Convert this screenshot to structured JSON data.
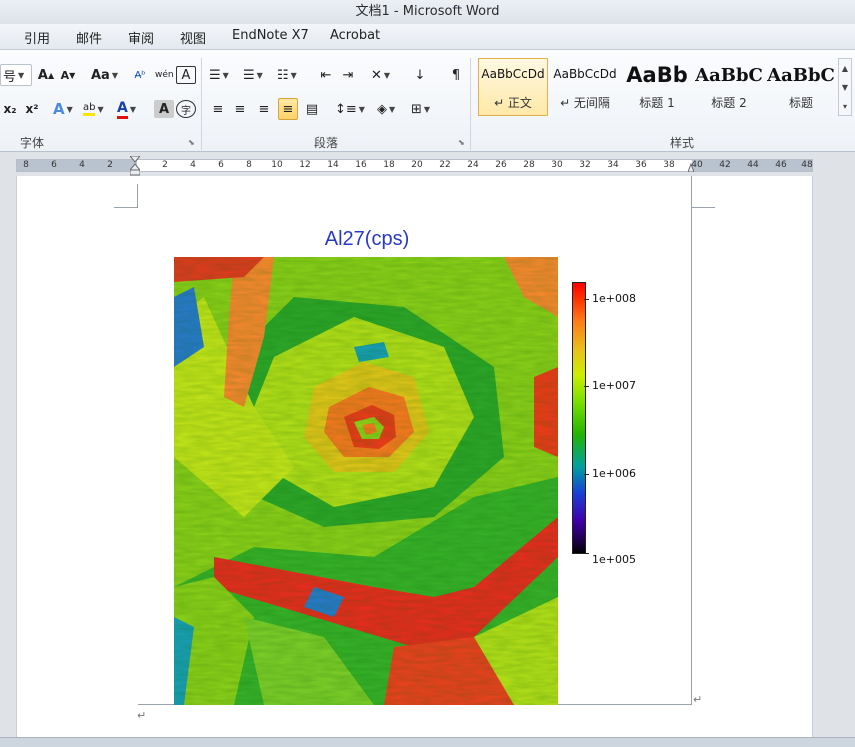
{
  "window": {
    "title": "文档1 - Microsoft Word"
  },
  "menu": {
    "tabs": [
      "引用",
      "邮件",
      "审阅",
      "视图",
      "EndNote X7",
      "Acrobat"
    ]
  },
  "ribbon": {
    "font_group_label": "字体",
    "paragraph_group_label": "段落",
    "styles_group_label": "样式",
    "font": {
      "size_fragment": "号",
      "grow_label": "A",
      "shrink_label": "A",
      "case_label": "Aa",
      "phonetic_label": "wén",
      "char_border_label": "A",
      "subscript_label": "x₂",
      "superscript_label": "x²",
      "effects_label": "A",
      "highlight_label": "ab",
      "font_color_label": "A",
      "char_shading_label": "A",
      "enclose_label": "字"
    },
    "styles": [
      {
        "sample": "AaBbCcDd",
        "name": "↵ 正文",
        "selected": true
      },
      {
        "sample": "AaBbCcDd",
        "name": "↵ 无间隔",
        "selected": false
      },
      {
        "sample": "AaBb",
        "name": "标题 1",
        "selected": false
      },
      {
        "sample": "AaBbC",
        "name": "标题 2",
        "selected": false
      },
      {
        "sample": "AaBbC",
        "name": "标题",
        "selected": false
      }
    ]
  },
  "ruler": {
    "left_ticks": [
      "8",
      "6",
      "4",
      "2"
    ],
    "right_ticks": [
      "2",
      "4",
      "6",
      "8",
      "10",
      "12",
      "14",
      "16",
      "18",
      "20",
      "22",
      "24",
      "26",
      "28",
      "30",
      "32",
      "34",
      "36",
      "38",
      "40",
      "42",
      "44",
      "46",
      "48"
    ]
  },
  "document": {
    "figure_title": "Al27(cps)",
    "paragraph_mark": "↵"
  },
  "chart_data": {
    "type": "heatmap",
    "title": "Al27(cps)",
    "colorbar": {
      "scale": "log",
      "range": [
        100000,
        200000000
      ],
      "tick_labels": [
        "1e+008",
        "1e+007",
        "1e+006",
        "1e+005"
      ],
      "colors": [
        "#ff0000",
        "#e8c21a",
        "#7adf00",
        "#23b400",
        "#00a0a0",
        "#1a3fd6",
        "#4000aa",
        "#000000"
      ]
    }
  }
}
